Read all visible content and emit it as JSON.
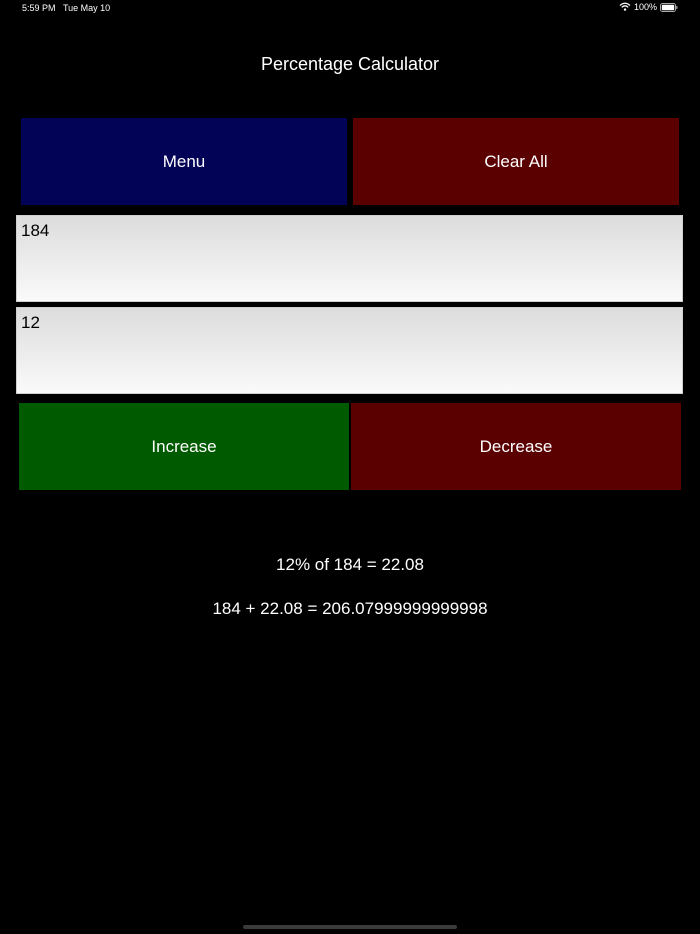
{
  "status_bar": {
    "time": "5:59 PM",
    "date": "Tue May 10",
    "battery_percent": "100%",
    "wifi_icon": "wifi-icon",
    "battery_icon": "battery-full-icon"
  },
  "header": {
    "title": "Percentage Calculator"
  },
  "top_buttons": {
    "menu_label": "Menu",
    "clear_all_label": "Clear All"
  },
  "inputs": {
    "base_number_value": "184",
    "percent_value": "12"
  },
  "action_buttons": {
    "increase_label": "Increase",
    "decrease_label": "Decrease"
  },
  "results": {
    "percent_line": "12% of 184 = 22.08",
    "total_line": "184 + 22.08 = 206.07999999999998"
  },
  "colors": {
    "background": "#000000",
    "menu_button": "#020257",
    "clear_all_button": "#5a0000",
    "increase_button": "#005a00",
    "decrease_button": "#5a0000",
    "text": "#ffffff"
  }
}
